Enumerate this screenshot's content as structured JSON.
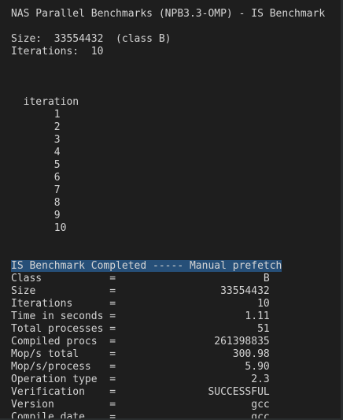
{
  "header": {
    "title": "NAS Parallel Benchmarks (NPB3.3-OMP) - IS Benchmark"
  },
  "config": {
    "size_line": "Size:  33554432  (class B)",
    "iterations_line": "Iterations:  10"
  },
  "iteration_section": {
    "header": "  iteration",
    "rows": [
      "       1",
      "       2",
      "       3",
      "       4",
      "       5",
      "       6",
      "       7",
      "       8",
      "       9",
      "       10"
    ]
  },
  "results": {
    "completed_banner": "IS Benchmark Completed ----- Manual prefetch",
    "rows": [
      "Class           =                        B",
      "Size            =                 33554432",
      "Iterations      =                       10",
      "Time in seconds =                     1.11",
      "Total processes =                       51",
      "Compiled procs  =                261398835",
      "Mop/s total     =                   300.98",
      "Mop/s/process   =                     5.90",
      "Operation type  =                      2.3",
      "Verification    =               SUCCESSFUL",
      "Version         =                      gcc",
      "Compile date    =                      gcc"
    ]
  }
}
